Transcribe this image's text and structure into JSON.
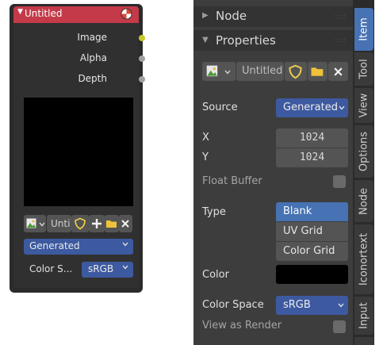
{
  "node": {
    "title": "Untitled",
    "outputs": {
      "image": "Image",
      "alpha": "Alpha",
      "depth": "Depth"
    },
    "image_name": "Unti",
    "source_value": "Generated",
    "color_space_label": "Color S...",
    "color_space_value": "sRGB",
    "colors": {
      "header": "#c43a49",
      "image_socket": "#c7c729",
      "value_socket": "#a1a1a1",
      "dropdown": "#3d5aa0"
    }
  },
  "panel": {
    "node_section": "Node",
    "properties_section": "Properties",
    "image_name": "Untitled",
    "source_label": "Source",
    "source_value": "Generated",
    "x_label": "X",
    "x_value": "1024",
    "y_label": "Y",
    "y_value": "1024",
    "float_buffer_label": "Float Buffer",
    "type_label": "Type",
    "type_options": [
      "Blank",
      "UV Grid",
      "Color Grid"
    ],
    "type_selected": "Blank",
    "color_label": "Color",
    "color_value": "#000000",
    "color_space_label": "Color Space",
    "color_space_value": "sRGB",
    "view_as_render_label": "View as Render"
  },
  "tabs": [
    "Item",
    "Tool",
    "View",
    "Options",
    "Node",
    "Iconortext",
    "Input"
  ],
  "active_tab": "Item"
}
